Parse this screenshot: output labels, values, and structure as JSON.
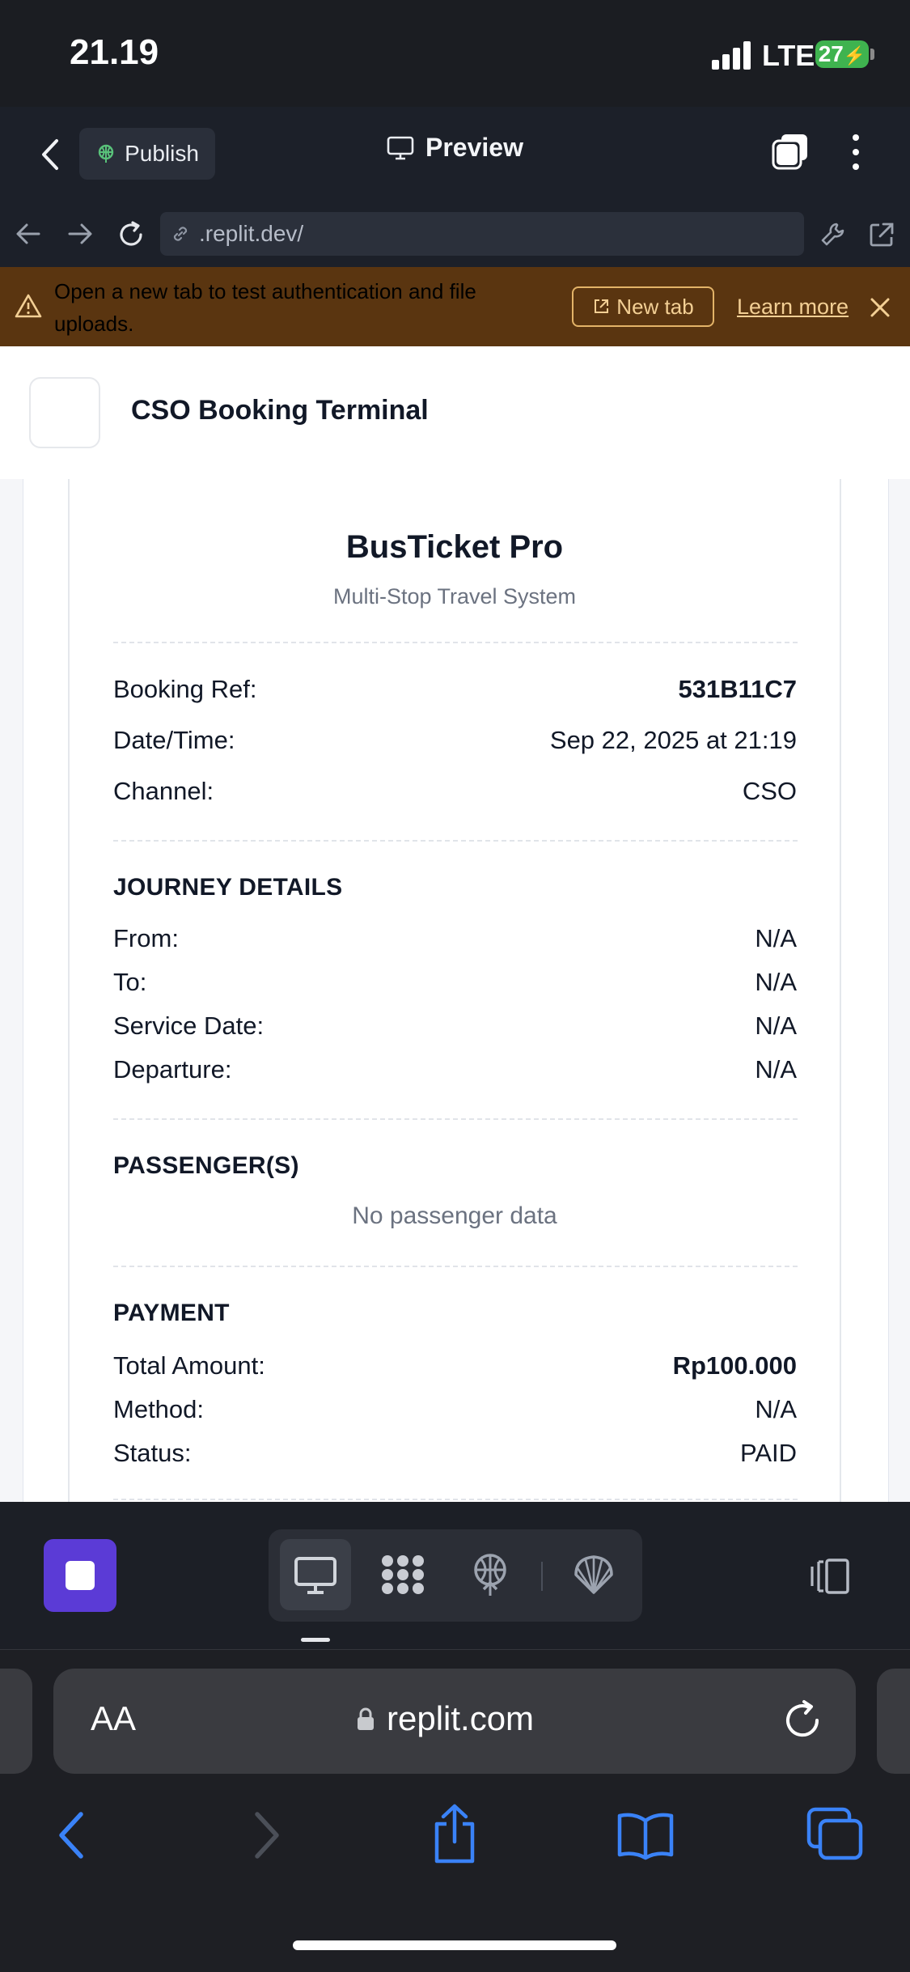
{
  "status_bar": {
    "time": "21.19",
    "network": "LTE",
    "battery": "27"
  },
  "app_header": {
    "publish_label": "Publish",
    "preview_label": "Preview"
  },
  "browser": {
    "url": ".replit.dev/"
  },
  "banner": {
    "message": "Open a new tab to test authentication and file uploads.",
    "new_tab_label": "New tab",
    "learn_more_label": "Learn more"
  },
  "app": {
    "title": "CSO Booking Terminal"
  },
  "ticket": {
    "title": "BusTicket Pro",
    "subtitle": "Multi-Stop Travel System",
    "booking": [
      {
        "label": "Booking Ref:",
        "value": "531B11C7"
      },
      {
        "label": "Date/Time:",
        "value": "Sep 22, 2025 at 21:19"
      },
      {
        "label": "Channel:",
        "value": "CSO"
      }
    ],
    "journey_heading": "JOURNEY DETAILS",
    "journey": [
      {
        "label": "From:",
        "value": "N/A"
      },
      {
        "label": "To:",
        "value": "N/A"
      },
      {
        "label": "Service Date:",
        "value": "N/A"
      },
      {
        "label": "Departure:",
        "value": "N/A"
      }
    ],
    "passengers_heading": "PASSENGER(S)",
    "passengers_empty": "No passenger data",
    "payment_heading": "PAYMENT",
    "payment": [
      {
        "label": "Total Amount:",
        "value": "Rp100.000"
      },
      {
        "label": "Method:",
        "value": "N/A"
      },
      {
        "label": "Status:",
        "value": "PAID"
      }
    ]
  },
  "safari": {
    "aa_label": "AA",
    "domain": "replit.com"
  },
  "colors": {
    "banner_bg": "#5a3510",
    "accent_purple": "#5b3bd6",
    "ios_blue": "#3a82f7",
    "battery_green": "#3fb34f"
  }
}
